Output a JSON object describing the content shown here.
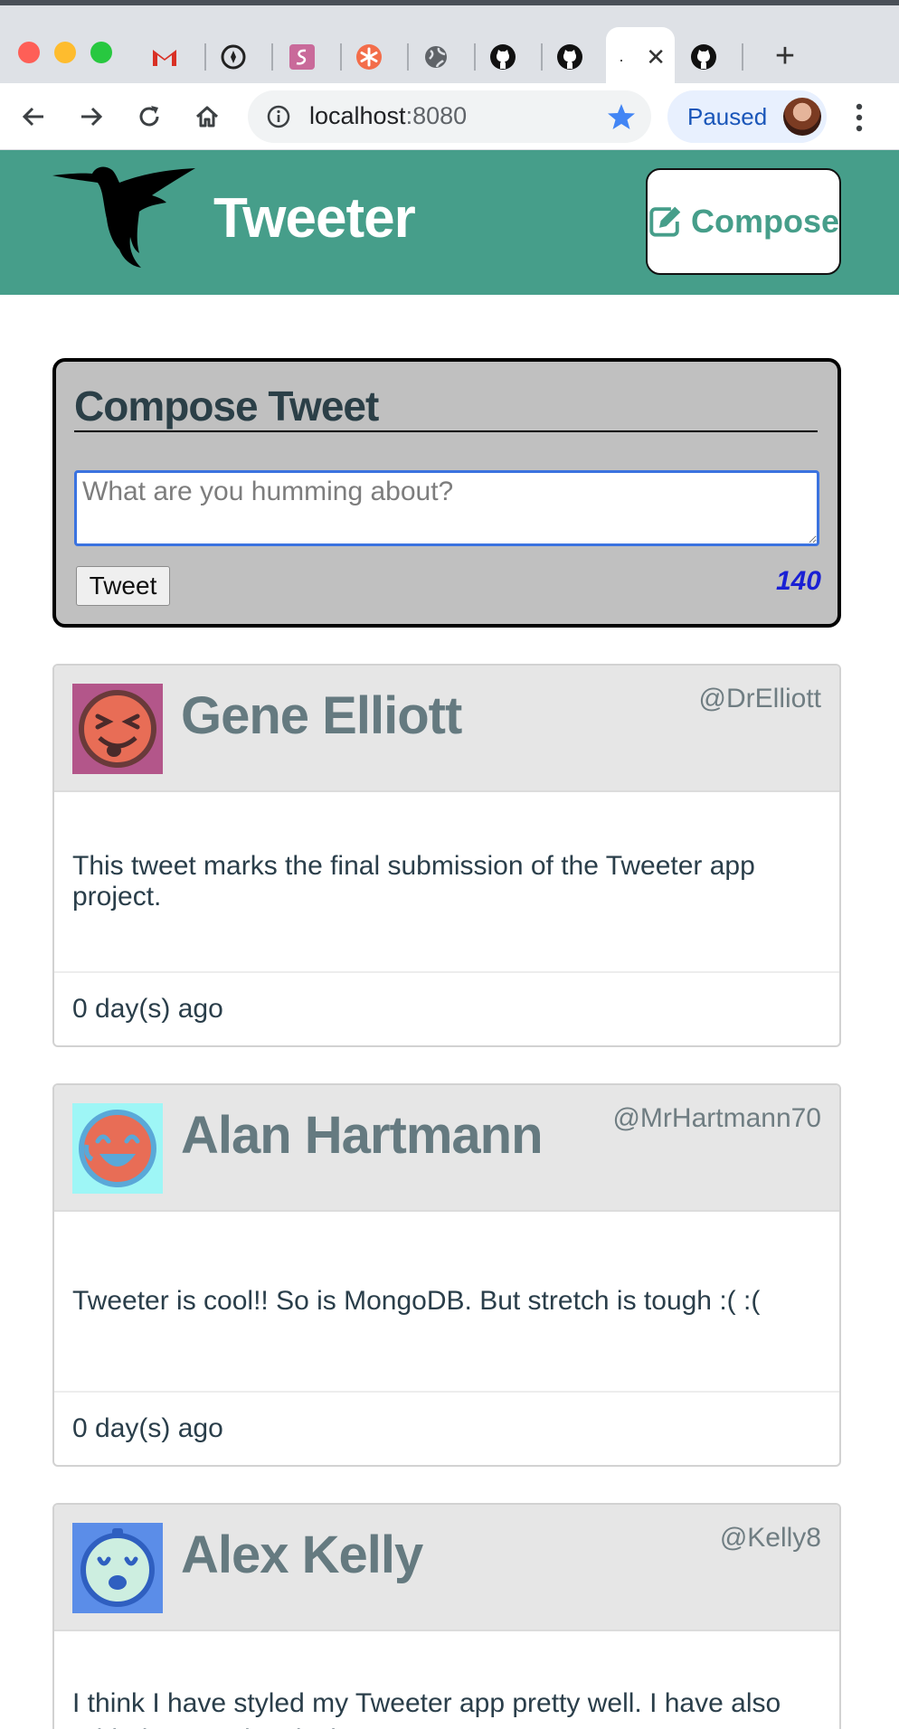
{
  "browser": {
    "tabs": [
      {
        "icon": "gmail-icon"
      },
      {
        "icon": "compass-icon"
      },
      {
        "icon": "swirl-icon"
      },
      {
        "icon": "asterisk-icon"
      },
      {
        "icon": "globe-icon"
      },
      {
        "icon": "github-icon"
      },
      {
        "icon": "github-icon"
      },
      {
        "icon": "active-tab",
        "active": true
      },
      {
        "icon": "github-icon"
      }
    ],
    "close_glyph": "✕",
    "new_tab_glyph": "+",
    "url_host": "localhost",
    "url_port": ":8080",
    "profile_status": "Paused",
    "colors": {
      "accent": "#4285f4",
      "paused_bg": "#e8f0fe"
    }
  },
  "header": {
    "brand": "Tweeter",
    "compose_label": "Compose",
    "background": "#469e8a"
  },
  "compose": {
    "title": "Compose Tweet",
    "placeholder": "What are you humming about?",
    "button_label": "Tweet",
    "counter": "140"
  },
  "tweets": [
    {
      "name": "Gene Elliott",
      "handle": "@DrElliott",
      "text": "This tweet marks the final submission of the Tweeter app project.",
      "age": "0 day(s) ago",
      "avatar": {
        "bg": "#b3568a",
        "face": "#e86d56",
        "icon": "wink-tongue-face-icon"
      }
    },
    {
      "name": "Alan Hartmann",
      "handle": "@MrHartmann70",
      "text": "Tweeter is cool!! So is MongoDB. But stretch is tough :( :(",
      "age": "0 day(s) ago",
      "avatar": {
        "bg": "#9ef6f6",
        "face": "#e86d56",
        "icon": "laughing-face-icon"
      }
    },
    {
      "name": "Alex Kelly",
      "handle": "@Kelly8",
      "text": "I think I have styled my Tweeter app pretty well. I have also added some nice design",
      "age": "",
      "avatar": {
        "bg": "#5b8de8",
        "face": "#cdeee0",
        "icon": "surprised-face-icon"
      }
    }
  ]
}
